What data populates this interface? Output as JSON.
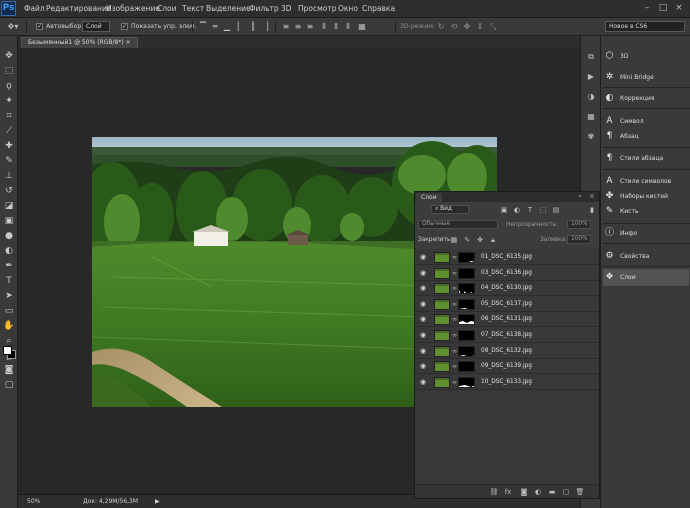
{
  "app": {
    "logo": "Ps",
    "minimize": "–",
    "maximize": "□",
    "close": "×"
  },
  "menu": [
    "Файл",
    "Редактирование",
    "Изображение",
    "Слои",
    "Текст",
    "Выделение",
    "Фильтр",
    "3D",
    "Просмотр",
    "Окно",
    "Справка"
  ],
  "options": {
    "autoselect_label": "Автовыбор:",
    "autoselect_value": "Слой",
    "show_controls_label": "Показать упр. элем.",
    "mode_3d_label": "3D-режим:",
    "workspace": "Новое в CS6"
  },
  "document": {
    "tab_title": "Безымянный1 @ 50% (RGB/8*)",
    "tab_close": "×"
  },
  "status": {
    "zoom": "50%",
    "doc_info": "Док: 4,29M/56,3M"
  },
  "right_panel": {
    "items": [
      "3D",
      "Mini Bridge",
      "Коррекция",
      "Символ",
      "Абзац",
      "Стили абзаца",
      "Стили символов",
      "Наборы кистей",
      "Кисть",
      "Инфо",
      "Свойства",
      "Слои"
    ]
  },
  "layers_panel": {
    "tab": "Слои",
    "filter_value": "Вид",
    "blend_mode": "Обычные",
    "opacity_label": "Непрозрачность:",
    "opacity_value": "100%",
    "lock_label": "Закрепить:",
    "fill_label": "Заливка:",
    "fill_value": "100%",
    "layers": [
      "01_DSC_6135.jpg",
      "03_DSC_6136.jpg",
      "04_DSC_6130.jpg",
      "05_DSC_6137.jpg",
      "06_DSC_6131.jpg",
      "07_DSC_6138.jpg",
      "08_DSC_6132.jpg",
      "09_DSC_6139.jpg",
      "10_DSC_6133.jpg"
    ]
  },
  "icons": {
    "toolbox": [
      "move-icon",
      "marquee-icon",
      "lasso-icon",
      "magic-wand-icon",
      "crop-icon",
      "eyedropper-icon",
      "healing-brush-icon",
      "brush-icon",
      "clone-stamp-icon",
      "history-brush-icon",
      "eraser-icon",
      "gradient-icon",
      "blur-icon",
      "dodge-icon",
      "pen-icon",
      "type-icon",
      "path-selection-icon",
      "rectangle-shape-icon",
      "hand-icon",
      "zoom-icon"
    ]
  }
}
